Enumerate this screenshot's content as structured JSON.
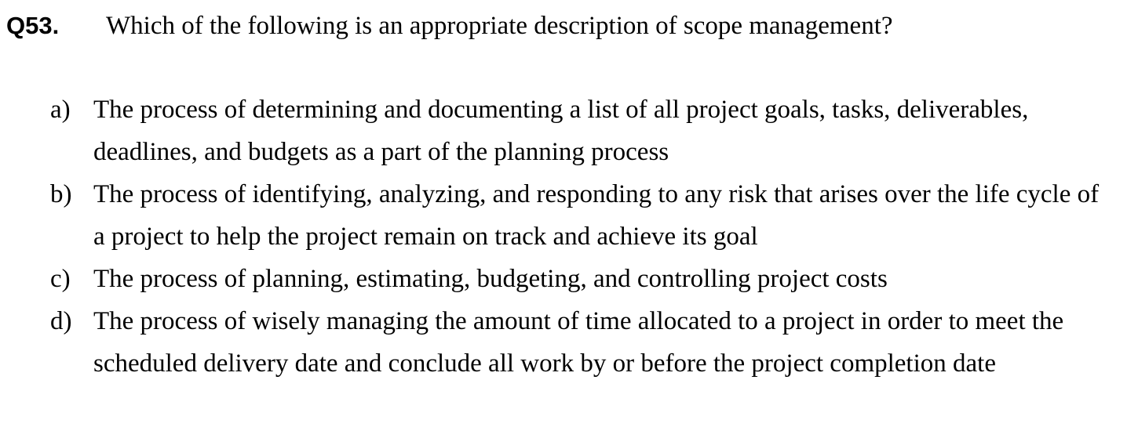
{
  "question": {
    "number": "Q53.",
    "text": "Which of the following is an appropriate description of scope management?"
  },
  "options": [
    {
      "letter": "a)",
      "text": "The process of determining and documenting a list of all project goals, tasks, deliverables, deadlines, and budgets as a part of the planning process"
    },
    {
      "letter": "b)",
      "text": "The process of identifying, analyzing, and responding to any risk that arises over the life cycle of a project to help the project remain on track and achieve its goal"
    },
    {
      "letter": "c)",
      "text": "The process of planning, estimating, budgeting, and controlling project costs"
    },
    {
      "letter": "d)",
      "text": "The process of wisely managing the amount of time allocated to a project in order to meet the scheduled delivery date and conclude all work by or before the project completion date"
    }
  ]
}
